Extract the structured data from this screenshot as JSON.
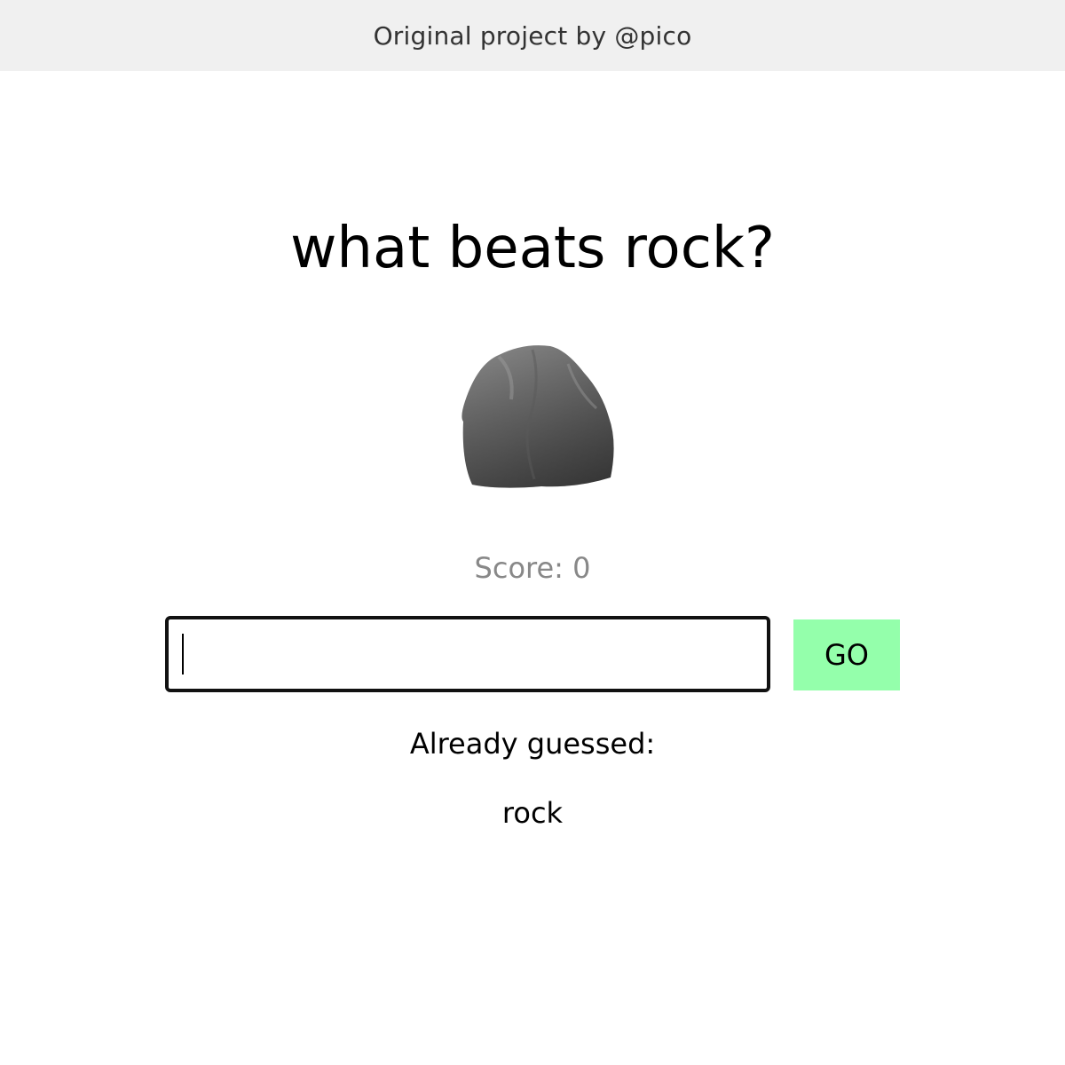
{
  "topbar": {
    "credit": "Original project by @pico"
  },
  "main": {
    "title": "what beats rock?",
    "current_item_icon": "rock-icon",
    "score_text": "Score: 0",
    "input": {
      "value": "",
      "placeholder": ""
    },
    "go_label": "GO",
    "already_guessed_label": "Already guessed:",
    "guessed_items": [
      "rock"
    ]
  },
  "colors": {
    "topbar_bg": "#f0f0f0",
    "go_button_bg": "#94ffab",
    "score_text": "#888888"
  }
}
